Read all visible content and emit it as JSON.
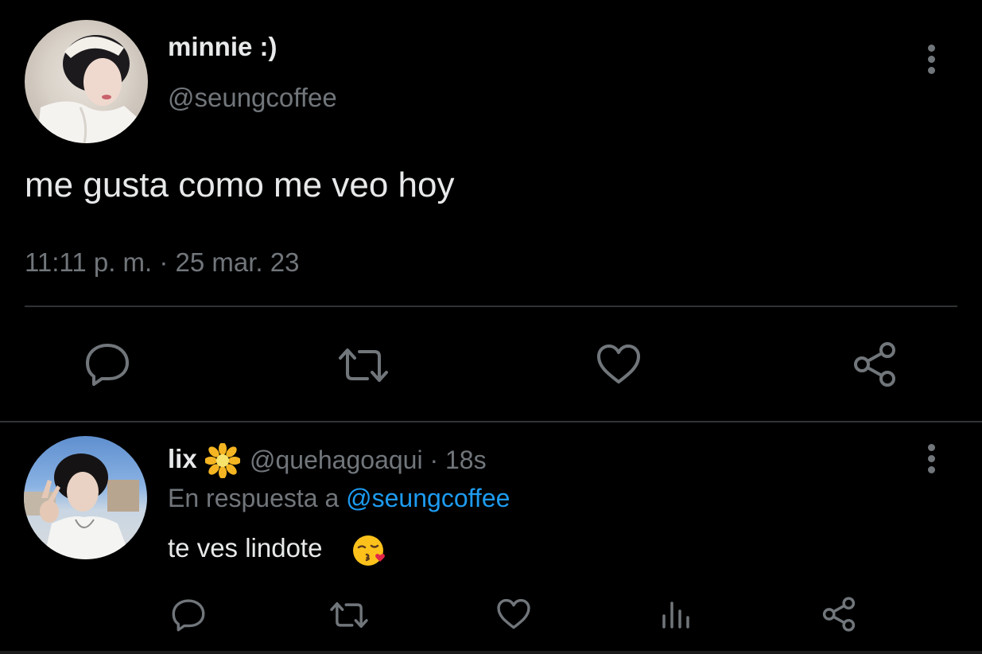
{
  "main_tweet": {
    "display_name": "minnie :)",
    "handle": "@seungcoffee",
    "text": "me gusta como me veo hoy",
    "timestamp": "11:11 p. m. · 25 mar. 23",
    "actions": [
      "reply-icon",
      "retweet-icon",
      "like-icon",
      "share-icon"
    ]
  },
  "reply_tweet": {
    "display_name": "lix",
    "name_emoji": "sunflower-emoji",
    "handle_time": "@quehagoaqui · 18s",
    "reply_prefix": "En respuesta a",
    "reply_mention": "@seungcoffee",
    "text": "te ves lindote",
    "text_emoji": "kissing-face-emoji",
    "actions": [
      "reply-icon",
      "retweet-icon",
      "like-icon",
      "analytics-icon",
      "share-icon"
    ]
  },
  "colors": {
    "background": "#000000",
    "text": "#e7e9ea",
    "secondary": "#71767b",
    "accent": "#1d9bf0",
    "divider": "#2f3336"
  }
}
